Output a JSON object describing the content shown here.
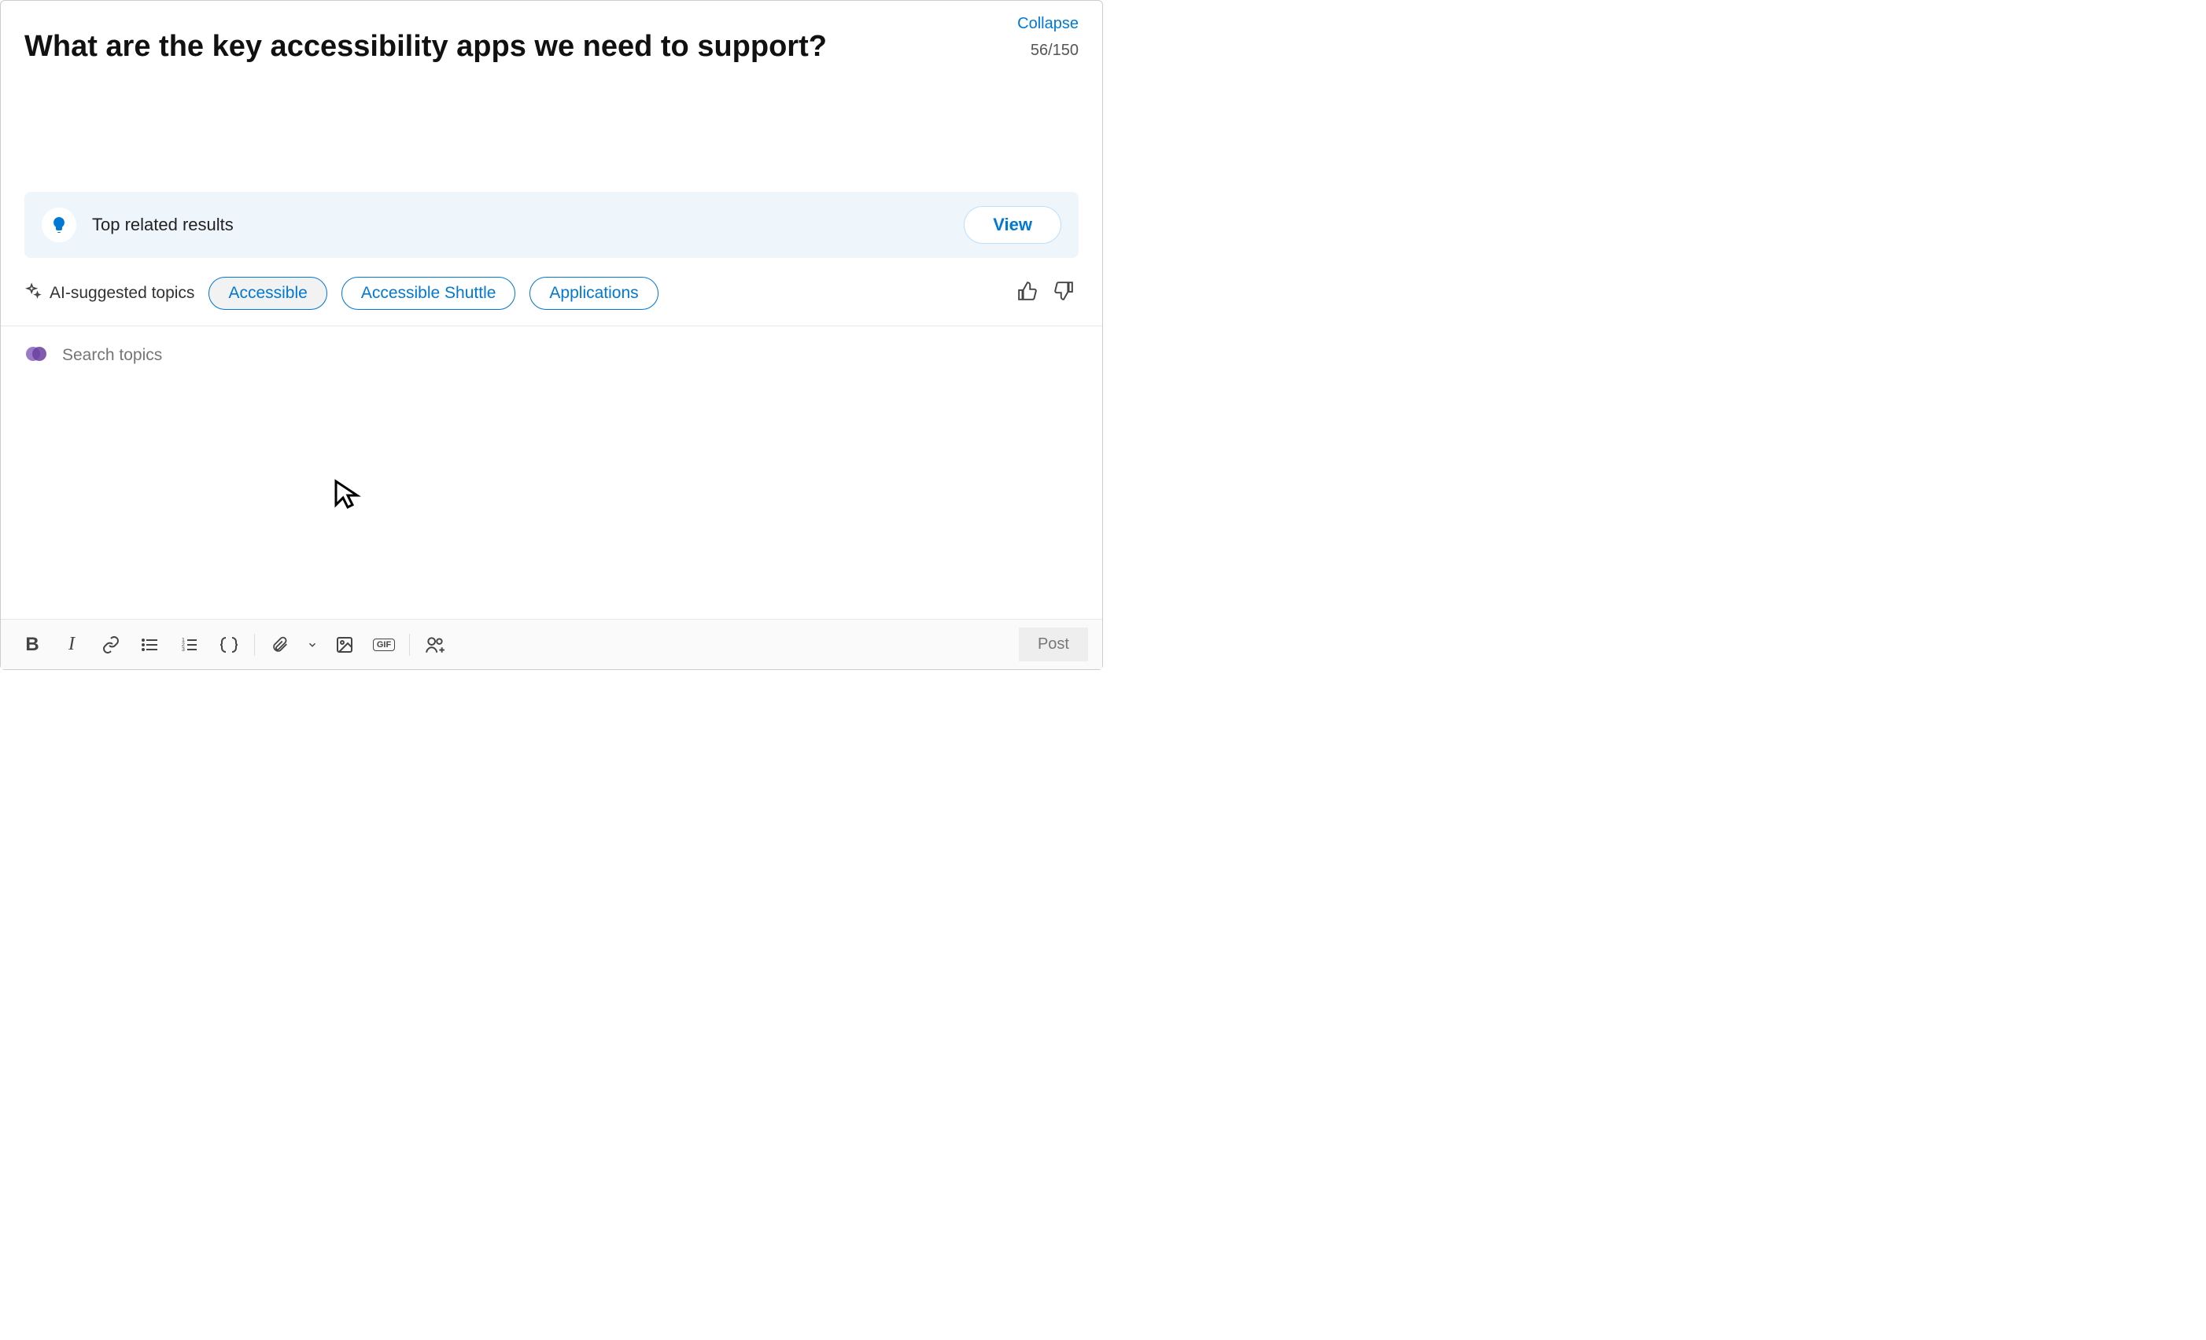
{
  "header": {
    "collapse_label": "Collapse",
    "char_count": "56/150"
  },
  "question": {
    "title": "What are the key accessibility apps we need to support?"
  },
  "related": {
    "label": "Top related results",
    "view_label": "View"
  },
  "suggestions": {
    "label": "AI-suggested topics",
    "topics": [
      "Accessible",
      "Accessible Shuttle",
      "Applications"
    ]
  },
  "search": {
    "placeholder": "Search topics"
  },
  "toolbar": {
    "bold": "B",
    "italic": "I",
    "gif": "GIF",
    "post_label": "Post"
  }
}
